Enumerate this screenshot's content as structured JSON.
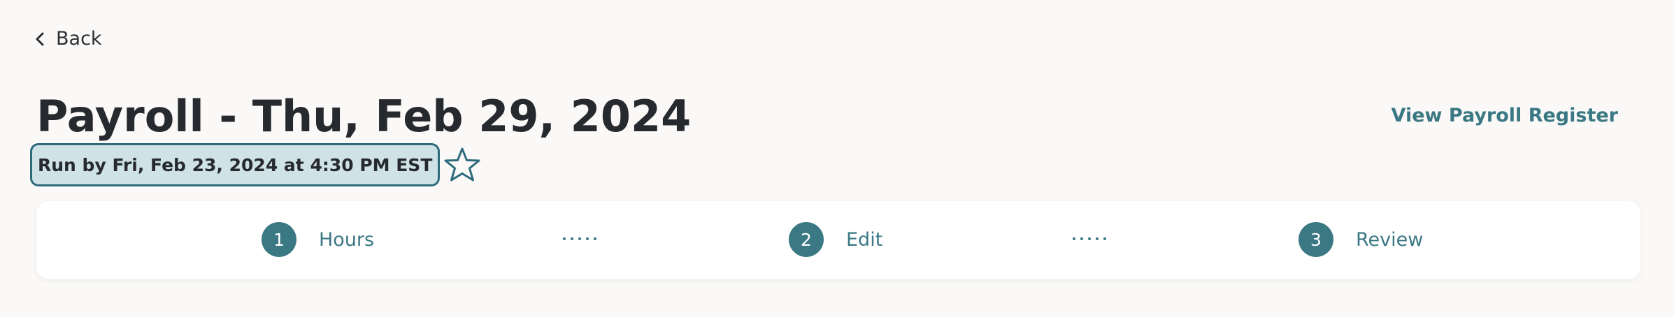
{
  "nav": {
    "back_label": "Back",
    "back_icon": "chevron-left-icon"
  },
  "header": {
    "title": "Payroll - Thu, Feb 29, 2024",
    "run_by": "Run by Fri, Feb 23, 2024 at 4:30 PM EST",
    "star_icon": "star-outline-icon",
    "view_register_label": "View Payroll Register"
  },
  "stepper": {
    "steps": [
      {
        "number": "1",
        "label": "Hours"
      },
      {
        "number": "2",
        "label": "Edit"
      },
      {
        "number": "3",
        "label": "Review"
      }
    ]
  },
  "colors": {
    "accent": "#3a7884",
    "badge_bg": "#cfe2e6",
    "badge_border": "#2d6b7c",
    "page_bg": "#faf9f7",
    "card_bg": "#ffffff",
    "text": "#26292e"
  }
}
